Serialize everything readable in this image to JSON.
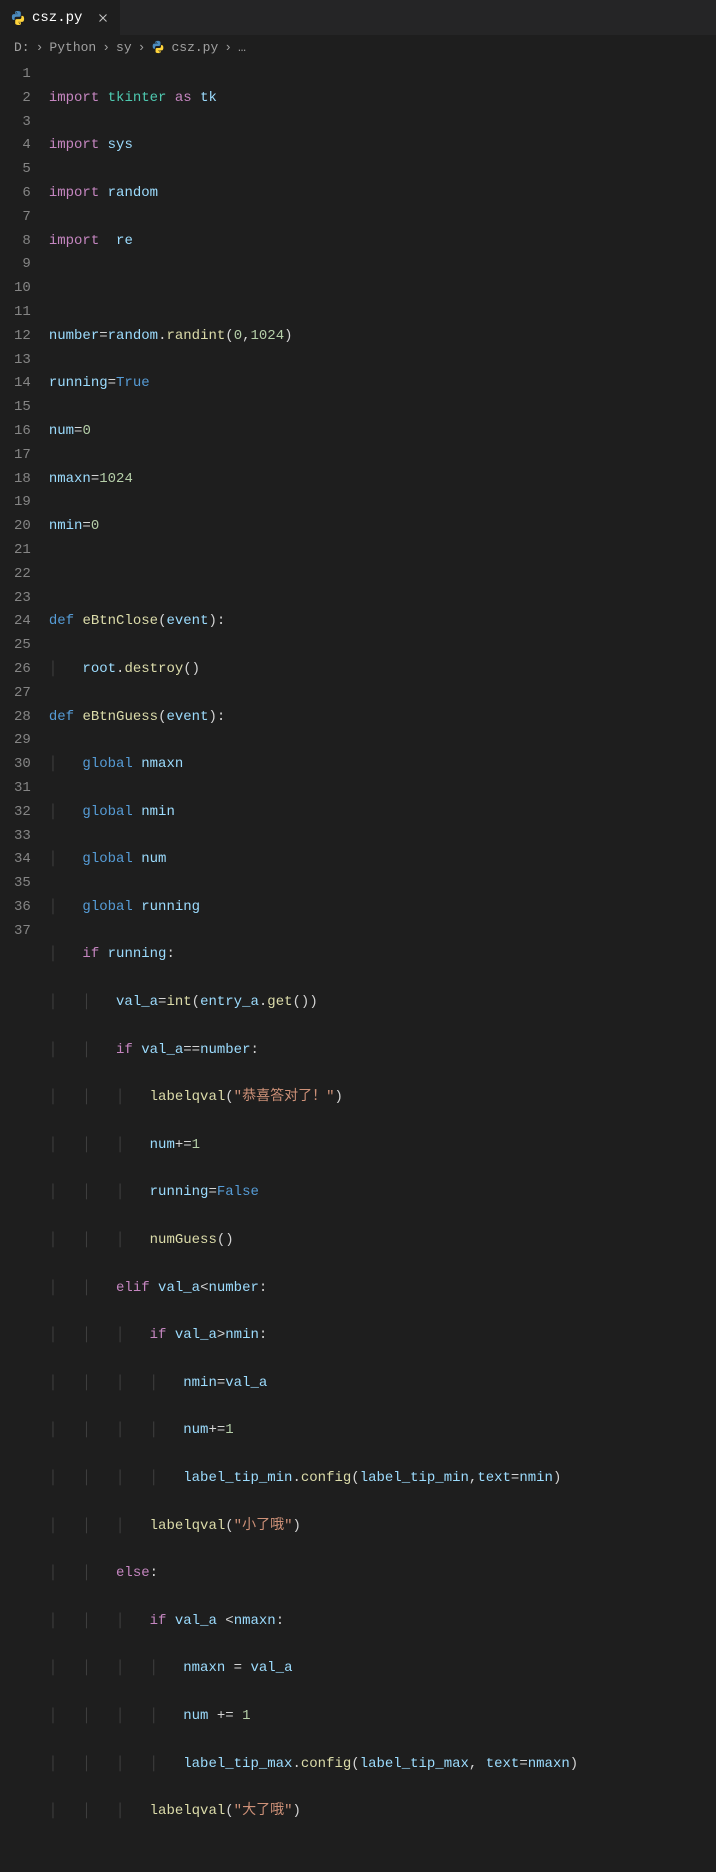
{
  "tab": {
    "filename": "csz.py"
  },
  "breadcrumb": {
    "drive": "D:",
    "folder1": "Python",
    "folder2": "sy",
    "file": "csz.py",
    "trail": "…"
  },
  "lines": [
    "1",
    "2",
    "3",
    "4",
    "5",
    "6",
    "7",
    "8",
    "9",
    "10",
    "11",
    "12",
    "13",
    "14",
    "15",
    "16",
    "17",
    "18",
    "19",
    "20",
    "21",
    "22",
    "23",
    "24",
    "25",
    "26",
    "27",
    "28",
    "29",
    "30",
    "31",
    "32",
    "33",
    "34",
    "35",
    "36",
    "37"
  ],
  "code": {
    "l1": {
      "import": "import",
      "tkinter": "tkinter",
      "as": "as",
      "tk": "tk"
    },
    "l2": {
      "import": "import",
      "sys": "sys"
    },
    "l3": {
      "import": "import",
      "random": "random"
    },
    "l4": {
      "import": "import",
      "re": "re"
    },
    "l6": {
      "number": "number",
      "eq": "=",
      "random": "random",
      "dot": ".",
      "randint": "randint",
      "lp": "(",
      "a0": "0",
      "c": ",",
      "a1": "1024",
      "rp": ")"
    },
    "l7": {
      "running": "running",
      "eq": "=",
      "True": "True"
    },
    "l8": {
      "num": "num",
      "eq": "=",
      "z": "0"
    },
    "l9": {
      "nmaxn": "nmaxn",
      "eq": "=",
      "v": "1024"
    },
    "l10": {
      "nmin": "nmin",
      "eq": "=",
      "v": "0"
    },
    "l12": {
      "def": "def",
      "name": "eBtnClose",
      "lp": "(",
      "event": "event",
      "rpc": "):"
    },
    "l13": {
      "root": "root",
      "dot": ".",
      "destroy": "destroy",
      "p": "()"
    },
    "l14": {
      "def": "def",
      "name": "eBtnGuess",
      "lp": "(",
      "event": "event",
      "rpc": "):"
    },
    "l15": {
      "global": "global",
      "v": "nmaxn"
    },
    "l16": {
      "global": "global",
      "v": "nmin"
    },
    "l17": {
      "global": "global",
      "v": "num"
    },
    "l18": {
      "global": "global",
      "v": "running"
    },
    "l19": {
      "if": "if",
      "v": "running",
      "c": ":"
    },
    "l20": {
      "val": "val_a",
      "eq": "=",
      "int": "int",
      "lp": "(",
      "entry": "entry_a",
      "dot": ".",
      "get": "get",
      "pp": "())"
    },
    "l21": {
      "if": "if",
      "val": "val_a",
      "op": "==",
      "number": "number",
      "c": ":"
    },
    "l22": {
      "fn": "labelqval",
      "lp": "(",
      "s": "\"恭喜答对了！\"",
      "rp": ")"
    },
    "l23": {
      "num": "num",
      "op": "+=",
      "v": "1"
    },
    "l24": {
      "running": "running",
      "eq": "=",
      "False": "False"
    },
    "l25": {
      "fn": "numGuess",
      "p": "()"
    },
    "l26": {
      "elif": "elif",
      "val": "val_a",
      "op": "<",
      "number": "number",
      "c": ":"
    },
    "l27": {
      "if": "if",
      "val": "val_a",
      "op": ">",
      "nmin": "nmin",
      "c": ":"
    },
    "l28": {
      "nmin": "nmin",
      "eq": "=",
      "val": "val_a"
    },
    "l29": {
      "num": "num",
      "op": "+=",
      "v": "1"
    },
    "l30": {
      "obj": "label_tip_min",
      "dot": ".",
      "fn": "config",
      "lp": "(",
      "a1": "label_tip_min",
      "c": ",",
      "kw": "text",
      "eq": "=",
      "a2": "nmin",
      "rp": ")"
    },
    "l31": {
      "fn": "labelqval",
      "lp": "(",
      "s": "\"小了哦\"",
      "rp": ")"
    },
    "l32": {
      "else": "else",
      "c": ":"
    },
    "l33": {
      "if": "if",
      "val": "val_a",
      "sp": " ",
      "op": "<",
      "nmaxn": "nmaxn",
      "c": ":"
    },
    "l34": {
      "nmaxn": "nmaxn",
      "eq": " = ",
      "val": "val_a"
    },
    "l35": {
      "num": "num",
      "op": " += ",
      "v": "1"
    },
    "l36": {
      "obj": "label_tip_max",
      "dot": ".",
      "fn": "config",
      "lp": "(",
      "a1": "label_tip_max",
      "c": ", ",
      "kw": "text",
      "eq": "=",
      "a2": "nmaxn",
      "rp": ")"
    },
    "l37": {
      "fn": "labelqval",
      "lp": "(",
      "s": "\"大了哦\"",
      "rp": ")"
    }
  },
  "chart_data": null
}
